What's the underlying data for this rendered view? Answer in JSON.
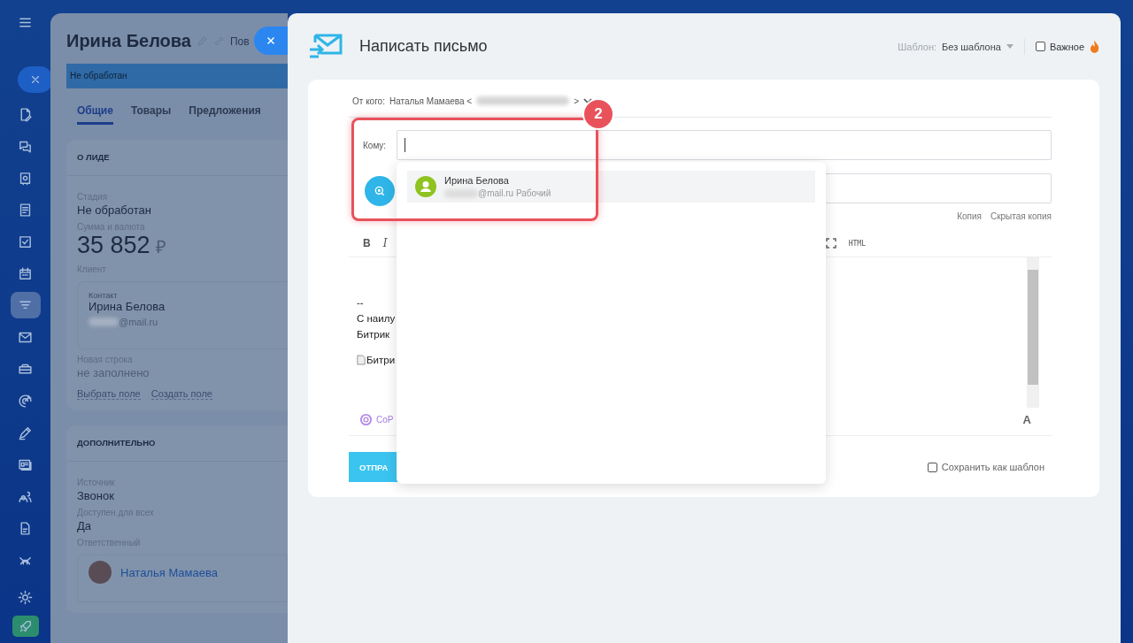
{
  "sidebar": {
    "items": [
      {
        "kind": "menu",
        "selected": false
      },
      {
        "kind": "close",
        "selected": false
      },
      {
        "kind": "document-edit",
        "selected": false
      },
      {
        "kind": "chat",
        "selected": false
      },
      {
        "kind": "camera",
        "selected": false
      },
      {
        "kind": "document-list",
        "selected": false
      },
      {
        "kind": "checkbox",
        "selected": false
      },
      {
        "kind": "calendar",
        "selected": false
      },
      {
        "kind": "funnel",
        "selected": true
      },
      {
        "kind": "mail",
        "selected": false
      },
      {
        "kind": "drive",
        "selected": false
      },
      {
        "kind": "target",
        "selected": false
      },
      {
        "kind": "pen",
        "selected": false
      },
      {
        "kind": "id-card",
        "selected": false
      },
      {
        "kind": "people",
        "selected": false
      },
      {
        "kind": "file",
        "selected": false
      },
      {
        "kind": "robot",
        "selected": false
      },
      {
        "kind": "settings",
        "selected": false
      },
      {
        "kind": "rocket",
        "selected": false
      }
    ]
  },
  "lead": {
    "title": "Ирина Белова",
    "title_cut": "Пов",
    "status": "Не обработан",
    "tabs": [
      {
        "label": "Общие",
        "selected": true
      },
      {
        "label": "Товары",
        "selected": false
      },
      {
        "label": "Предложения",
        "selected": false
      }
    ],
    "about": {
      "heading": "О ЛИДЕ",
      "stage_label": "Стадия",
      "stage": "Не обработан",
      "sum_label": "Сумма и валюта",
      "sum": "35 852",
      "currency": "₽",
      "client_label": "Клиент",
      "contact": {
        "label": "Контакт",
        "name": "Ирина Белова",
        "email": "@mail.ru"
      },
      "new_label": "Новая строка",
      "new_value": "не заполнено",
      "links": [
        "Выбрать поле",
        "Создать поле"
      ]
    },
    "extra": {
      "heading": "ДОПОЛНИТЕЛЬНО",
      "fields": [
        {
          "label": "Источник",
          "value": "Звонок"
        },
        {
          "label": "Доступен для всех",
          "value": "Да"
        }
      ],
      "responsible_label": "Ответственный",
      "responsible": "Наталья Мамаева"
    }
  },
  "email": {
    "title": "Написать письмо",
    "template_label": "Шаблон:",
    "template": "Без шаблона",
    "important": {
      "label": "Важное",
      "checked": false
    },
    "from_label": "От кого:",
    "from_name": "Наталья Мамаева <",
    "from_end": ">",
    "to_label": "Кому:",
    "cc": "Копия",
    "bcc": "Скрытая копия",
    "toolbar": [
      "B",
      "I"
    ],
    "toolbar_html": "HTML",
    "body": [
      "--",
      "С наилу",
      "Битрик"
    ],
    "image_alt": "Битри",
    "copilot": "CoP",
    "font_key": "A",
    "send": "ОТПРА",
    "save_template": {
      "label": "Сохранить как шаблон",
      "checked": false
    },
    "suggestions": [
      {
        "name": "Ирина Белова",
        "email": "@mail.ru",
        "type": "Рабочий",
        "selected": true
      }
    ],
    "callout": "2"
  }
}
